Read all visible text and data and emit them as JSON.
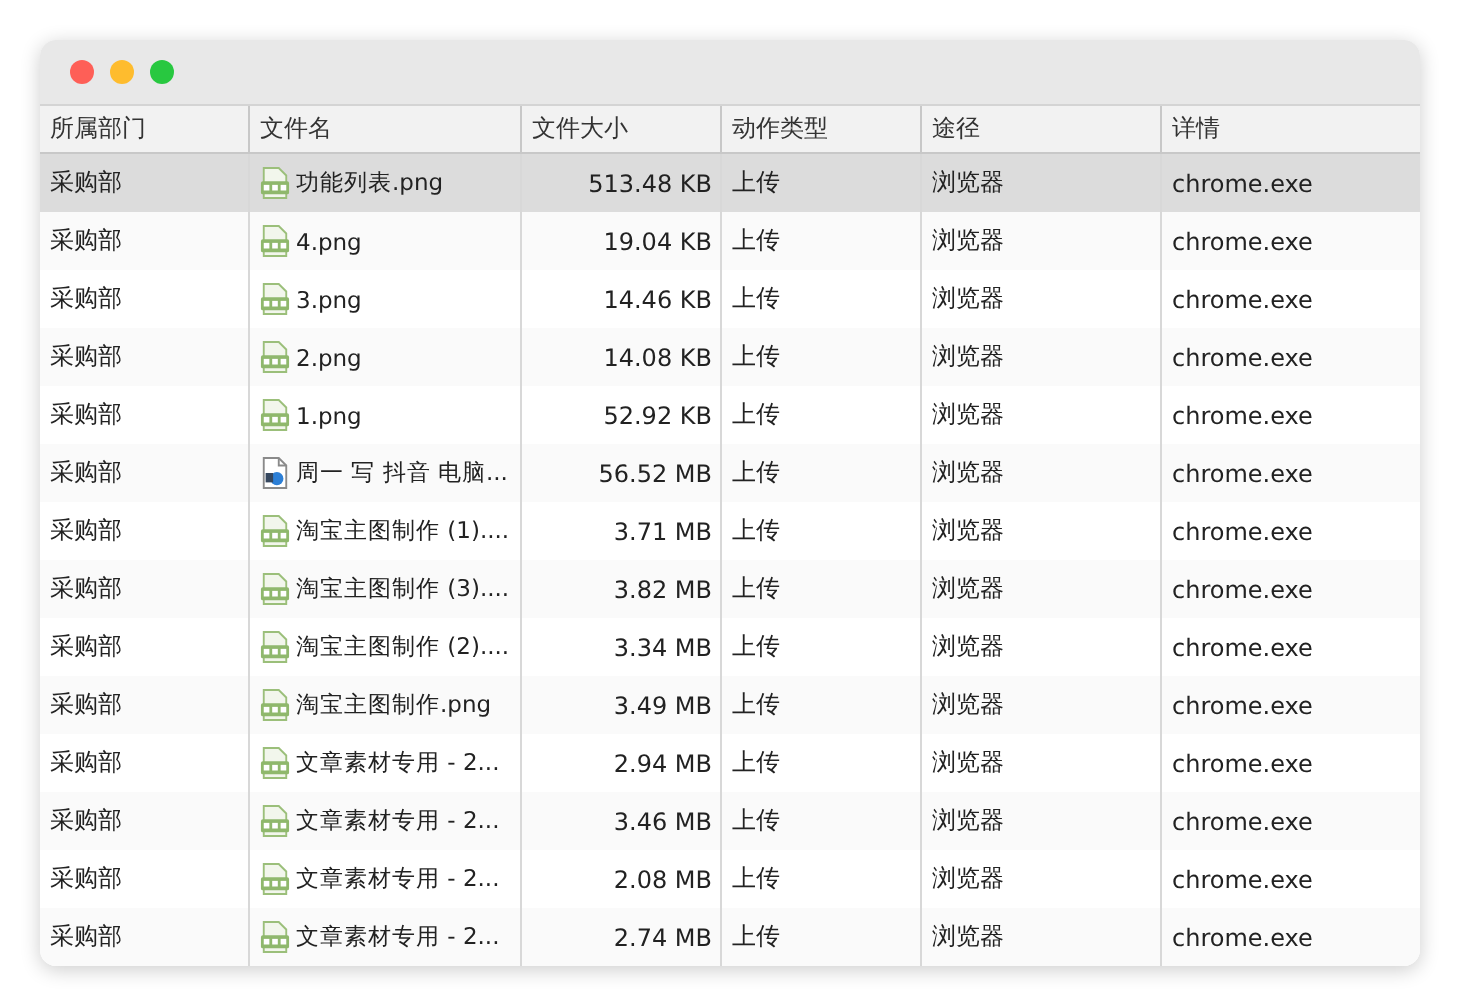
{
  "window": {
    "controls": [
      {
        "color": "#fe5f57"
      },
      {
        "color": "#febc2e"
      },
      {
        "color": "#28c840"
      }
    ]
  },
  "table": {
    "columns": [
      "所属部门",
      "文件名",
      "文件大小",
      "动作类型",
      "途径",
      "详情"
    ],
    "rows": [
      {
        "selected": true,
        "department": "采购部",
        "file": {
          "kind": "png",
          "name": "功能列表.png"
        },
        "size": "513.48 KB",
        "action": "上传",
        "route": "浏览器",
        "detail": "chrome.exe"
      },
      {
        "selected": false,
        "department": "采购部",
        "file": {
          "kind": "png",
          "name": "4.png"
        },
        "size": "19.04 KB",
        "action": "上传",
        "route": "浏览器",
        "detail": "chrome.exe"
      },
      {
        "selected": false,
        "department": "采购部",
        "file": {
          "kind": "png",
          "name": "3.png"
        },
        "size": "14.46 KB",
        "action": "上传",
        "route": "浏览器",
        "detail": "chrome.exe"
      },
      {
        "selected": false,
        "department": "采购部",
        "file": {
          "kind": "png",
          "name": "2.png"
        },
        "size": "14.08 KB",
        "action": "上传",
        "route": "浏览器",
        "detail": "chrome.exe"
      },
      {
        "selected": false,
        "department": "采购部",
        "file": {
          "kind": "png",
          "name": "1.png"
        },
        "size": "52.92 KB",
        "action": "上传",
        "route": "浏览器",
        "detail": "chrome.exe"
      },
      {
        "selected": false,
        "department": "采购部",
        "file": {
          "kind": "video",
          "name": "周一 写 抖音 电脑..."
        },
        "size": "56.52 MB",
        "action": "上传",
        "route": "浏览器",
        "detail": "chrome.exe"
      },
      {
        "selected": false,
        "department": "采购部",
        "file": {
          "kind": "png",
          "name": "淘宝主图制作 (1)...."
        },
        "size": "3.71 MB",
        "action": "上传",
        "route": "浏览器",
        "detail": "chrome.exe"
      },
      {
        "selected": false,
        "department": "采购部",
        "file": {
          "kind": "png",
          "name": "淘宝主图制作 (3)...."
        },
        "size": "3.82 MB",
        "action": "上传",
        "route": "浏览器",
        "detail": "chrome.exe"
      },
      {
        "selected": false,
        "department": "采购部",
        "file": {
          "kind": "png",
          "name": "淘宝主图制作 (2)...."
        },
        "size": "3.34 MB",
        "action": "上传",
        "route": "浏览器",
        "detail": "chrome.exe"
      },
      {
        "selected": false,
        "department": "采购部",
        "file": {
          "kind": "png",
          "name": "淘宝主图制作.png"
        },
        "size": "3.49 MB",
        "action": "上传",
        "route": "浏览器",
        "detail": "chrome.exe"
      },
      {
        "selected": false,
        "department": "采购部",
        "file": {
          "kind": "png",
          "name": "文章素材专用 - 2..."
        },
        "size": "2.94 MB",
        "action": "上传",
        "route": "浏览器",
        "detail": "chrome.exe"
      },
      {
        "selected": false,
        "department": "采购部",
        "file": {
          "kind": "png",
          "name": "文章素材专用 - 2..."
        },
        "size": "3.46 MB",
        "action": "上传",
        "route": "浏览器",
        "detail": "chrome.exe"
      },
      {
        "selected": false,
        "department": "采购部",
        "file": {
          "kind": "png",
          "name": "文章素材专用 - 2..."
        },
        "size": "2.08 MB",
        "action": "上传",
        "route": "浏览器",
        "detail": "chrome.exe"
      },
      {
        "selected": false,
        "department": "采购部",
        "file": {
          "kind": "png",
          "name": "文章素材专用 - 2..."
        },
        "size": "2.74 MB",
        "action": "上传",
        "route": "浏览器",
        "detail": "chrome.exe"
      }
    ]
  }
}
